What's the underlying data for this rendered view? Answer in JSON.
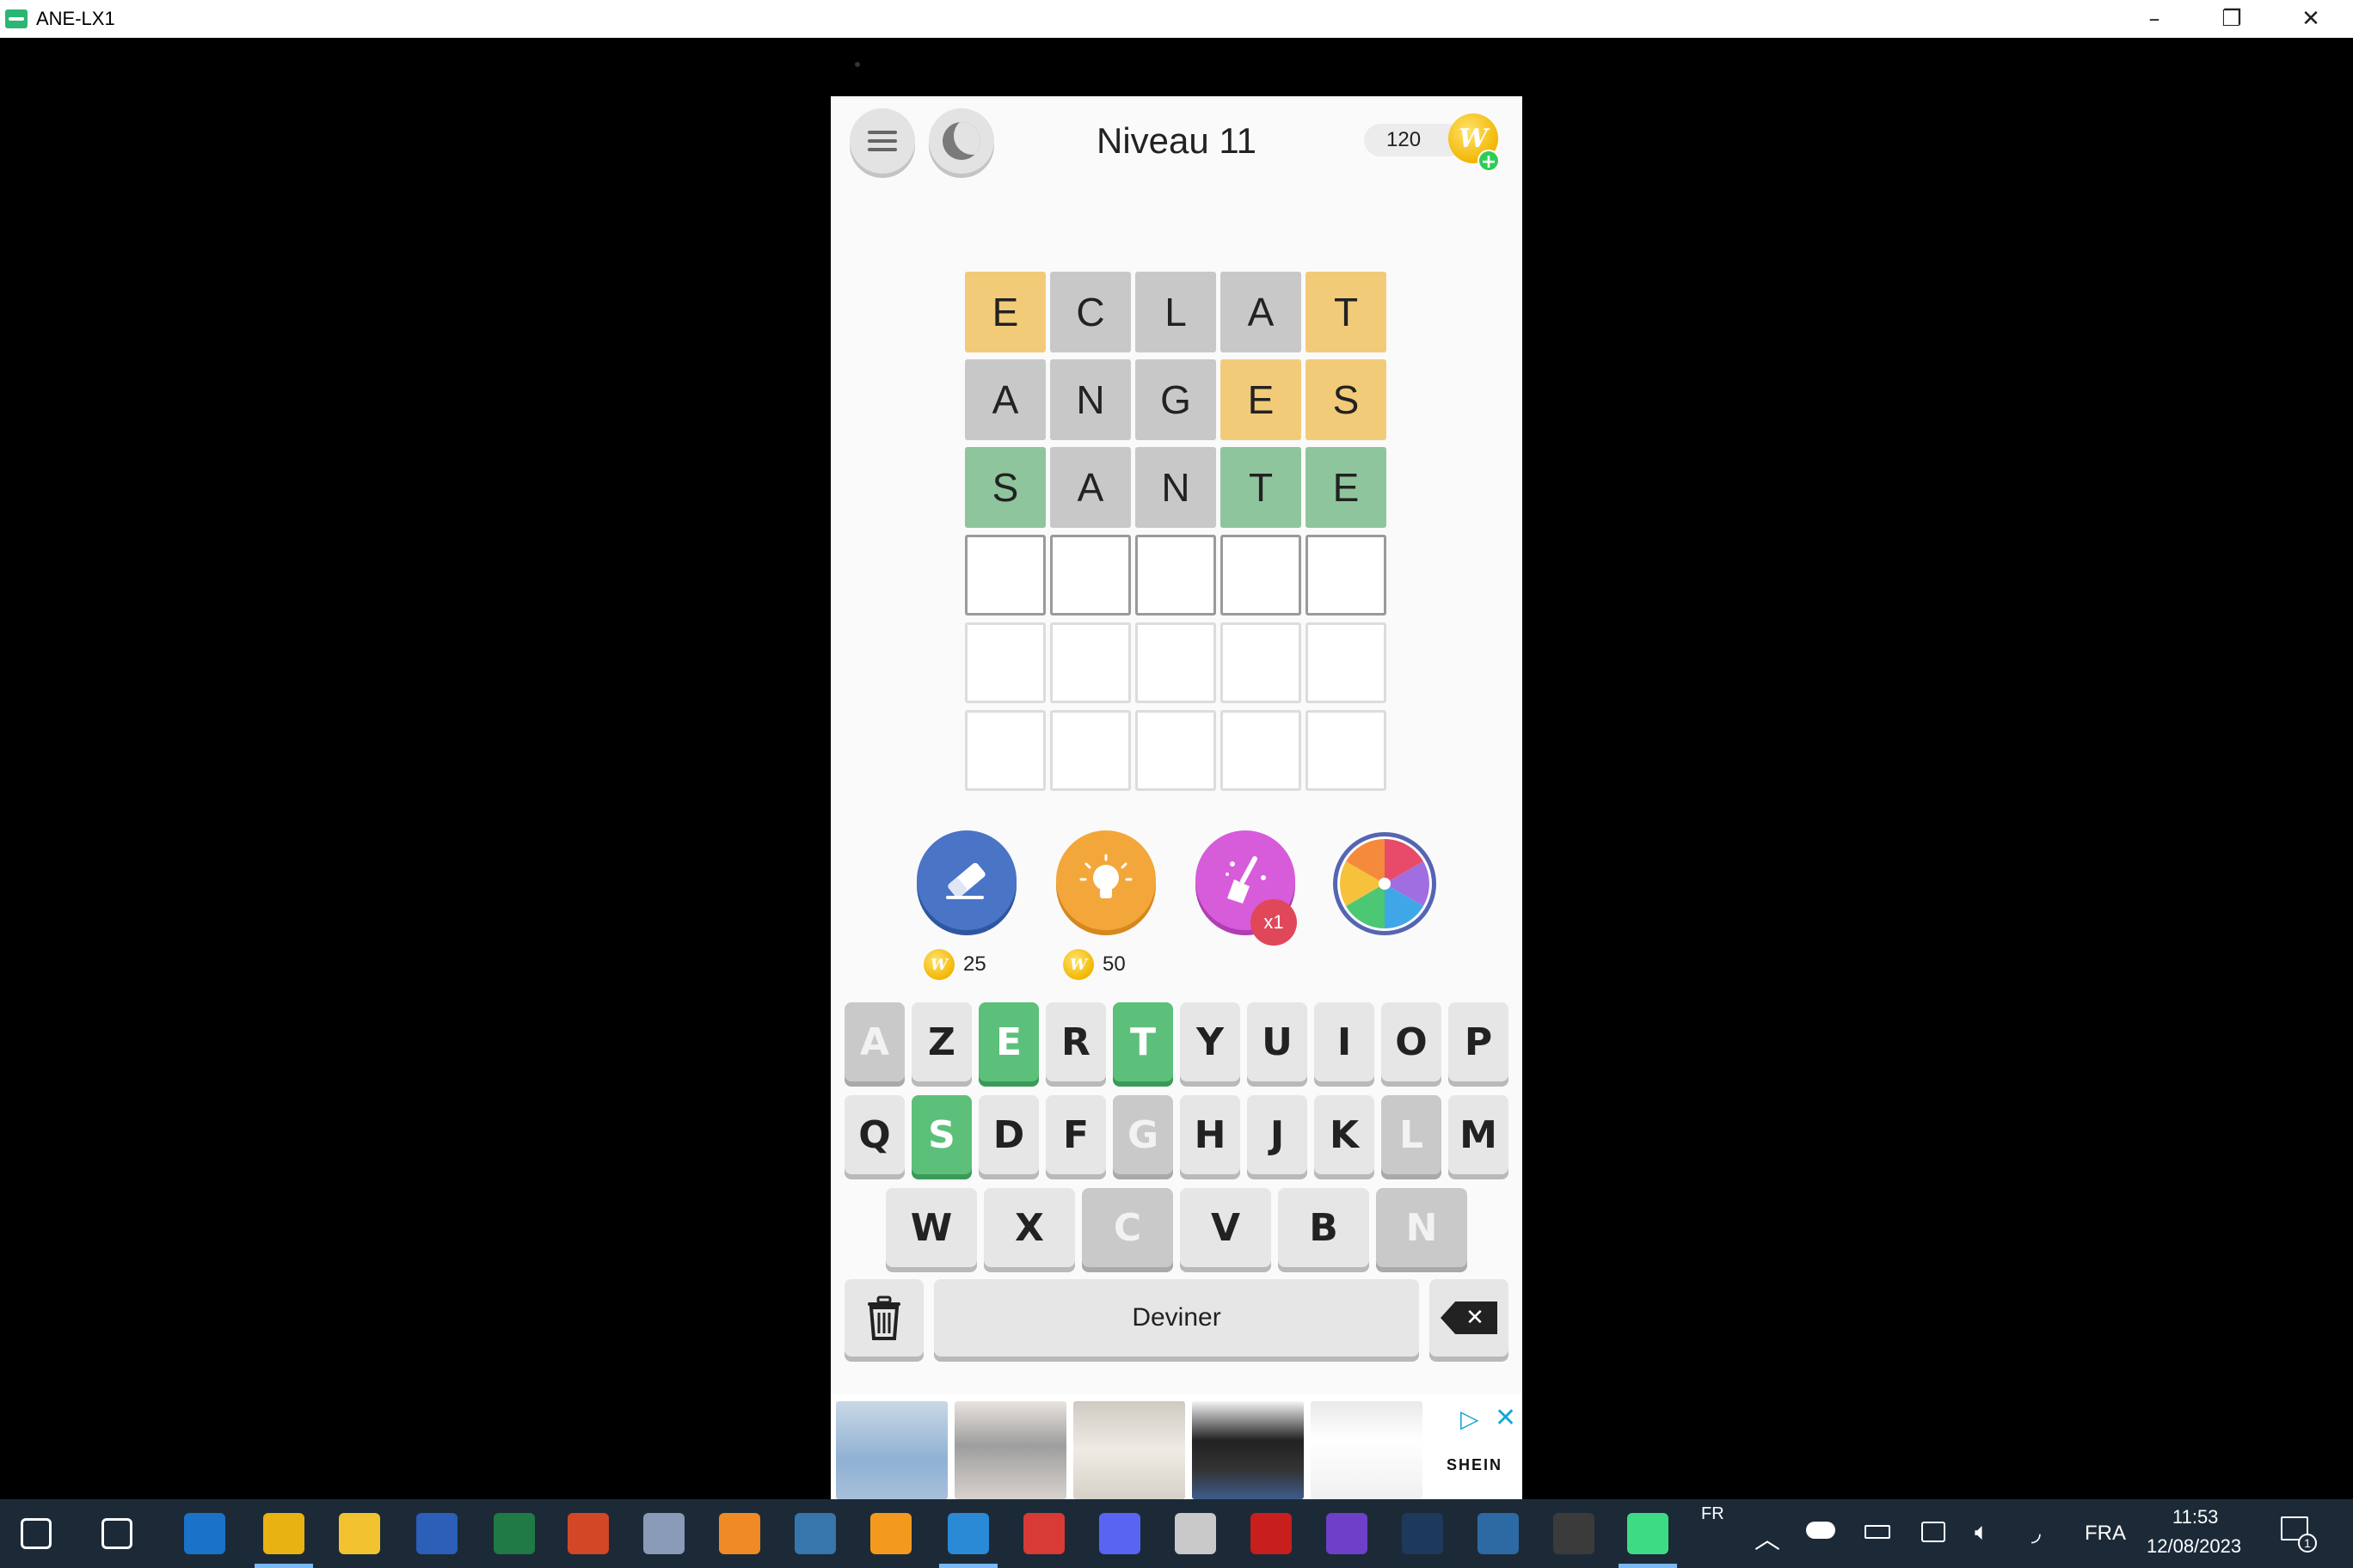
{
  "window": {
    "title": "ANE-LX1",
    "minimize": "–",
    "maximize": "❐",
    "close": "✕"
  },
  "header": {
    "level": "Niveau 11",
    "coins": "120",
    "coin_symbol": "W",
    "add_symbol": "+"
  },
  "grid": [
    [
      {
        "l": "E",
        "s": "present"
      },
      {
        "l": "C",
        "s": "absent"
      },
      {
        "l": "L",
        "s": "absent"
      },
      {
        "l": "A",
        "s": "absent"
      },
      {
        "l": "T",
        "s": "present"
      }
    ],
    [
      {
        "l": "A",
        "s": "absent"
      },
      {
        "l": "N",
        "s": "absent"
      },
      {
        "l": "G",
        "s": "absent"
      },
      {
        "l": "E",
        "s": "present"
      },
      {
        "l": "S",
        "s": "present"
      }
    ],
    [
      {
        "l": "S",
        "s": "correct"
      },
      {
        "l": "A",
        "s": "absent"
      },
      {
        "l": "N",
        "s": "absent"
      },
      {
        "l": "T",
        "s": "correct"
      },
      {
        "l": "E",
        "s": "correct"
      }
    ],
    [
      {
        "l": "",
        "s": "active"
      },
      {
        "l": "",
        "s": "active"
      },
      {
        "l": "",
        "s": "active"
      },
      {
        "l": "",
        "s": "active"
      },
      {
        "l": "",
        "s": "active"
      }
    ],
    [
      {
        "l": "",
        "s": "empty"
      },
      {
        "l": "",
        "s": "empty"
      },
      {
        "l": "",
        "s": "empty"
      },
      {
        "l": "",
        "s": "empty"
      },
      {
        "l": "",
        "s": "empty"
      }
    ],
    [
      {
        "l": "",
        "s": "empty"
      },
      {
        "l": "",
        "s": "empty"
      },
      {
        "l": "",
        "s": "empty"
      },
      {
        "l": "",
        "s": "empty"
      },
      {
        "l": "",
        "s": "empty"
      }
    ]
  ],
  "powerups": {
    "erase_cost": "25",
    "hint_cost": "50",
    "sweep_badge": "x1"
  },
  "keyboard": {
    "row1": [
      {
        "k": "A",
        "s": "used"
      },
      {
        "k": "Z",
        "s": ""
      },
      {
        "k": "E",
        "s": "hit"
      },
      {
        "k": "R",
        "s": ""
      },
      {
        "k": "T",
        "s": "hit"
      },
      {
        "k": "Y",
        "s": ""
      },
      {
        "k": "U",
        "s": ""
      },
      {
        "k": "I",
        "s": ""
      },
      {
        "k": "O",
        "s": ""
      },
      {
        "k": "P",
        "s": ""
      }
    ],
    "row2": [
      {
        "k": "Q",
        "s": ""
      },
      {
        "k": "S",
        "s": "hit"
      },
      {
        "k": "D",
        "s": ""
      },
      {
        "k": "F",
        "s": ""
      },
      {
        "k": "G",
        "s": "used"
      },
      {
        "k": "H",
        "s": ""
      },
      {
        "k": "J",
        "s": ""
      },
      {
        "k": "K",
        "s": ""
      },
      {
        "k": "L",
        "s": "used"
      },
      {
        "k": "M",
        "s": ""
      }
    ],
    "row3": [
      {
        "k": "W",
        "s": ""
      },
      {
        "k": "X",
        "s": ""
      },
      {
        "k": "C",
        "s": "used"
      },
      {
        "k": "V",
        "s": ""
      },
      {
        "k": "B",
        "s": ""
      },
      {
        "k": "N",
        "s": "used"
      }
    ],
    "guess_label": "Deviner",
    "backspace_symbol": "✕"
  },
  "ad": {
    "brand": "SHEIN",
    "close": "✕",
    "play": "▷"
  },
  "taskbar": {
    "lang_top": "FR",
    "lang": "FRA",
    "time": "11:53",
    "date": "12/08/2023",
    "notification_count": "1",
    "icons": [
      "windows-start",
      "task-view",
      "outlook",
      "chrome",
      "file-explorer",
      "word",
      "excel",
      "powerpoint",
      "snipping",
      "media-player",
      "python",
      "sublime-text",
      "vscode",
      "scissors",
      "discord",
      "tux",
      "acrobat",
      "github",
      "lightroom",
      "terminal",
      "obs",
      "android-emulator"
    ]
  },
  "colors": {
    "present": "#f2cb79",
    "absent": "#c8c8c8",
    "correct": "#8fc59c",
    "key_hit": "#5cc07a"
  }
}
